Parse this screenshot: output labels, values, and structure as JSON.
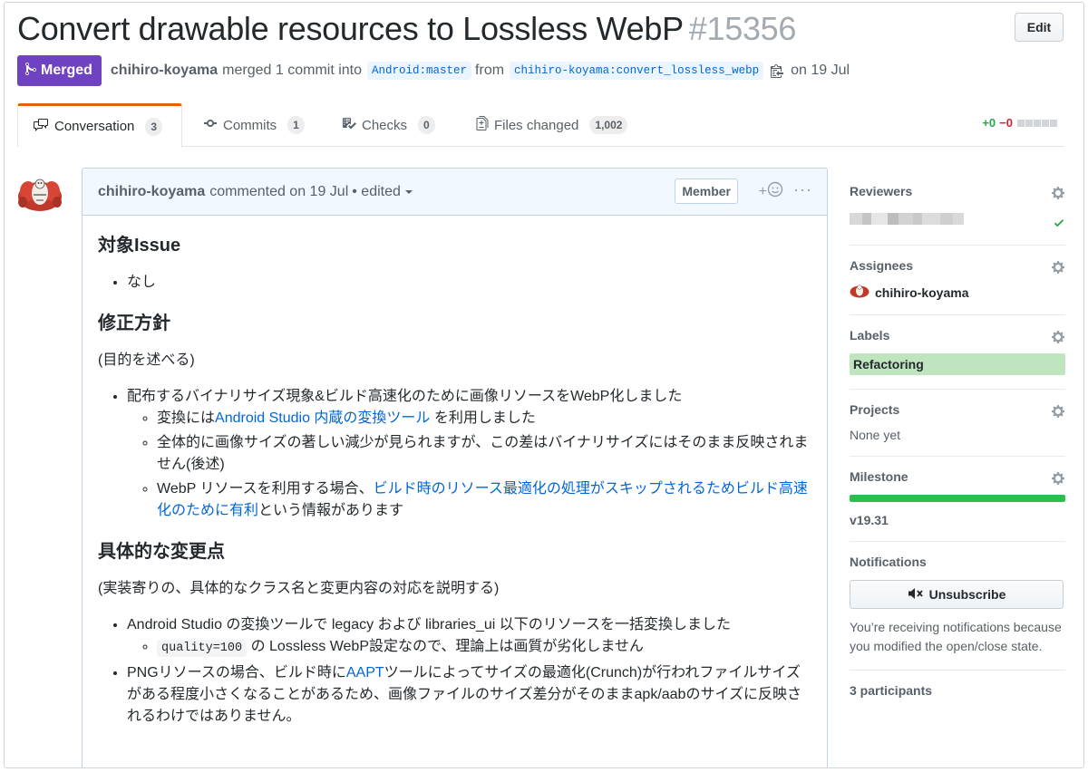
{
  "header": {
    "title": "Convert drawable resources to Lossless WebP",
    "number": "#15356",
    "edit_label": "Edit"
  },
  "meta": {
    "status_label": "Merged",
    "author": "chihiro-koyama",
    "merged_text": "merged 1 commit into",
    "base_branch": "Android:master",
    "from_text": "from",
    "head_branch": "chihiro-koyama:convert_lossless_webp",
    "date_text": "on 19 Jul"
  },
  "tabs": [
    {
      "label": "Conversation",
      "count": "3"
    },
    {
      "label": "Commits",
      "count": "1"
    },
    {
      "label": "Checks",
      "count": "0"
    },
    {
      "label": "Files changed",
      "count": "1,002"
    }
  ],
  "diffstat": {
    "additions": "+0",
    "deletions": "−0"
  },
  "comment": {
    "author": "chihiro-koyama",
    "time": "commented on 19 Jul",
    "edited": "• edited",
    "badge": "Member",
    "reaction": "+",
    "more": "···",
    "body": {
      "h_issue": "対象Issue",
      "issue_item": "なし",
      "h_policy": "修正方針",
      "policy_intro": "(目的を述べる)",
      "policy_item": "配布するバイナリサイズ現象&ビルド高速化のために画像リソースをWebP化しました",
      "sub1_pre": "変換には",
      "sub1_link": "Android Studio 内蔵の変換ツール",
      "sub1_post": " を利用しました",
      "sub2": "全体的に画像サイズの著しい減少が見られますが、この差はバイナリサイズにはそのまま反映されません(後述)",
      "sub3_pre": "WebP リソースを利用する場合、",
      "sub3_link": "ビルド時のリソース最適化の処理がスキップされるためビルド高速化のために有利",
      "sub3_post": "という情報があります",
      "h_changes": "具体的な変更点",
      "changes_intro": "(実装寄りの、具体的なクラス名と変更内容の対応を説明する)",
      "change1": "Android Studio の変換ツールで legacy および libraries_ui 以下のリソースを一括変換しました",
      "change1_sub_code": "quality=100",
      "change1_sub_text": " の Lossless WebP設定なので、理論上は画質が劣化しません",
      "change2_pre": "PNGリソースの場合、ビルド時に",
      "change2_link": "AAPT",
      "change2_post": "ツールによってサイズの最適化(Crunch)が行われファイルサイズがある程度小さくなることがあるため、画像ファイルのサイズ差分がそのままapk/aabのサイズに反映されるわけではありません。"
    }
  },
  "sidebar": {
    "reviewers_title": "Reviewers",
    "assignees_title": "Assignees",
    "assignee": "chihiro-koyama",
    "labels_title": "Labels",
    "label": "Refactoring",
    "projects_title": "Projects",
    "projects_value": "None yet",
    "milestone_title": "Milestone",
    "milestone_progress": 1.0,
    "milestone_name": "v19.31",
    "notifications_title": "Notifications",
    "unsubscribe_label": "Unsubscribe",
    "notification_note": "You’re receiving notifications because you modified the open/close state.",
    "participants_title": "3 participants"
  },
  "colors": {
    "merged": "#6f42c1",
    "link": "#0366d6",
    "label_bg": "#bfe5bf",
    "milestone": "#2cbe4e",
    "additions": "#28a745",
    "deletions": "#cb2431"
  },
  "icons": [
    "merge-icon",
    "copy-icon",
    "comment-discussion-icon",
    "commit-icon",
    "checklist-icon",
    "file-diff-icon",
    "smiley-icon",
    "kebab-icon",
    "gear-icon",
    "check-icon",
    "mute-icon"
  ]
}
